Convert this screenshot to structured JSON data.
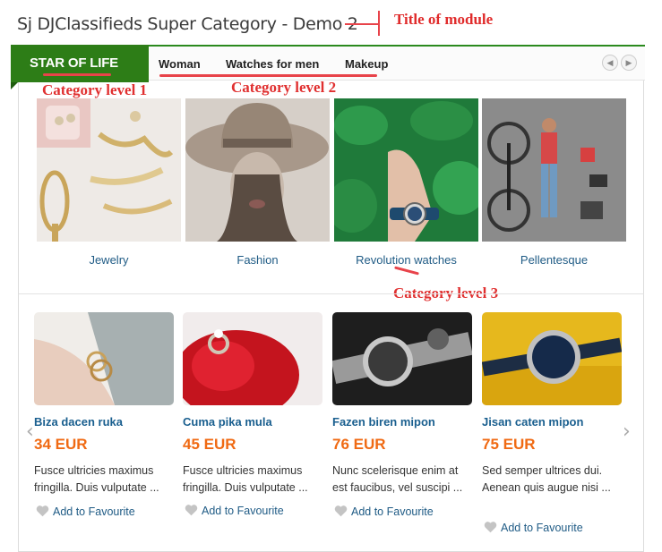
{
  "module": {
    "title": "Sj DJClassifieds Super Category - Demo 2"
  },
  "annotations": {
    "title_of_module": "Title of module",
    "category_level_1": "Category level 1",
    "category_level_2": "Category level 2",
    "category_level_3": "Category level 3",
    "color": "#e8434a"
  },
  "tabs": {
    "active": "STAR OF LIFE",
    "items": [
      "Woman",
      "Watches for men",
      "Makeup"
    ],
    "prev_icon": "chevron-left-icon",
    "next_icon": "chevron-right-icon",
    "accent": "#2d7d17"
  },
  "categories": [
    {
      "label": "Jewelry"
    },
    {
      "label": "Fashion"
    },
    {
      "label": "Revolution watches"
    },
    {
      "label": "Pellentesque"
    }
  ],
  "products": [
    {
      "name": "Biza dacen ruka",
      "price": "34 EUR",
      "desc": "Fusce ultricies maximus fringilla. Duis vulputate ...",
      "fav": "Add to Favourite"
    },
    {
      "name": "Cuma pika mula",
      "price": "45 EUR",
      "desc": "Fusce ultricies maximus fringilla. Duis vulputate ...",
      "fav": "Add to Favourite"
    },
    {
      "name": "Fazen biren mipon",
      "price": "76 EUR",
      "desc": "Nunc scelerisque enim at est faucibus, vel suscipi ...",
      "fav": "Add to Favourite"
    },
    {
      "name": "Jisan caten mipon",
      "price": "75 EUR",
      "desc": "Sed semper ultrices dui. Aenean quis augue nisi ...",
      "fav": "Add to Favourite"
    }
  ],
  "colors": {
    "price": "#f06a13",
    "link": "#1f5b85"
  }
}
